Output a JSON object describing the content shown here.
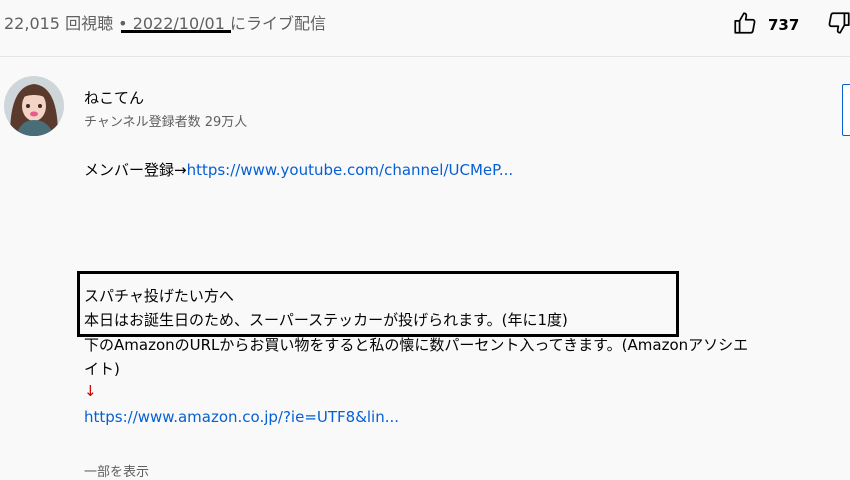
{
  "stats": {
    "views": "22,015 回視聴",
    "separator": " • ",
    "date": "2022/10/01",
    "suffix": " にライブ配信"
  },
  "actions": {
    "like_count": "737",
    "like_icon": "thumb-up-icon",
    "dislike_icon": "thumb-down-icon"
  },
  "channel": {
    "name": "ねこてん",
    "subscribers": "チャンネル登録者数 29万人"
  },
  "description": {
    "member_prefix": "メンバー登録→",
    "member_link": "https://www.youtube.com/channel/UCMeP...",
    "superchat_title": "スパチャ投げたい方へ",
    "superchat_note": "本日はお誕生日のため、スーパーステッカーが投げられます。(年に1度)",
    "amazon_note_line1": "下のAmazonのURLからお買い物をすると私の懐に数パーセント入ってきます。(Amazonアソシエ",
    "amazon_note_line2": "イト)",
    "arrow": "↓",
    "amazon_link": "https://www.amazon.co.jp/?ie=UTF8&lin..."
  },
  "show_more": "一部を表示",
  "colors": {
    "link": "#065fd4",
    "secondary_text": "#606060",
    "arrow": "#cc0000"
  }
}
